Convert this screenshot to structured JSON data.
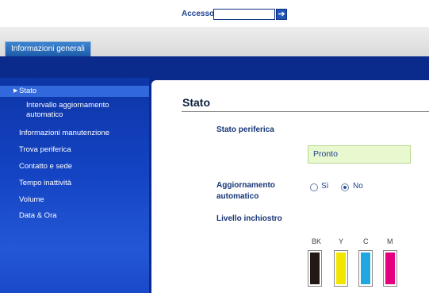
{
  "login": {
    "label": "Accesso",
    "value": "",
    "go_icon": "arrow-right-icon",
    "go_glyph": "➔"
  },
  "tabs": [
    {
      "label": "Informazioni generali",
      "active": true
    }
  ],
  "sidebar": {
    "items": [
      {
        "label": "Stato",
        "active": true
      },
      {
        "label": "Intervallo aggiornamento automatico",
        "line1": "Intervallo aggiornamento",
        "line2": "automatico"
      },
      {
        "label": "Informazioni manutenzione"
      },
      {
        "label": "Trova periferica"
      },
      {
        "label": "Contatto e sede"
      },
      {
        "label": "Tempo inattività"
      },
      {
        "label": "Volume"
      },
      {
        "label": "Data & Ora"
      }
    ]
  },
  "main": {
    "title": "Stato",
    "device_status_label": "Stato periferica",
    "device_status_value": "Pronto",
    "auto_refresh_label_1": "Aggiornamento",
    "auto_refresh_label_2": "automatico",
    "auto_refresh_options": [
      {
        "label": "Sì",
        "checked": false
      },
      {
        "label": "No",
        "checked": true
      }
    ],
    "ink_level_label": "Livello inchiostro",
    "inks": [
      {
        "name": "BK",
        "color": "#231815",
        "level": 1.0
      },
      {
        "name": "Y",
        "color": "#f2e600",
        "level": 1.0
      },
      {
        "name": "C",
        "color": "#1ea7e1",
        "level": 1.0
      },
      {
        "name": "M",
        "color": "#e4007f",
        "level": 1.0
      }
    ]
  },
  "colors": {
    "brand_blue": "#0a2a8c",
    "status_bg": "#e8f8cf"
  }
}
